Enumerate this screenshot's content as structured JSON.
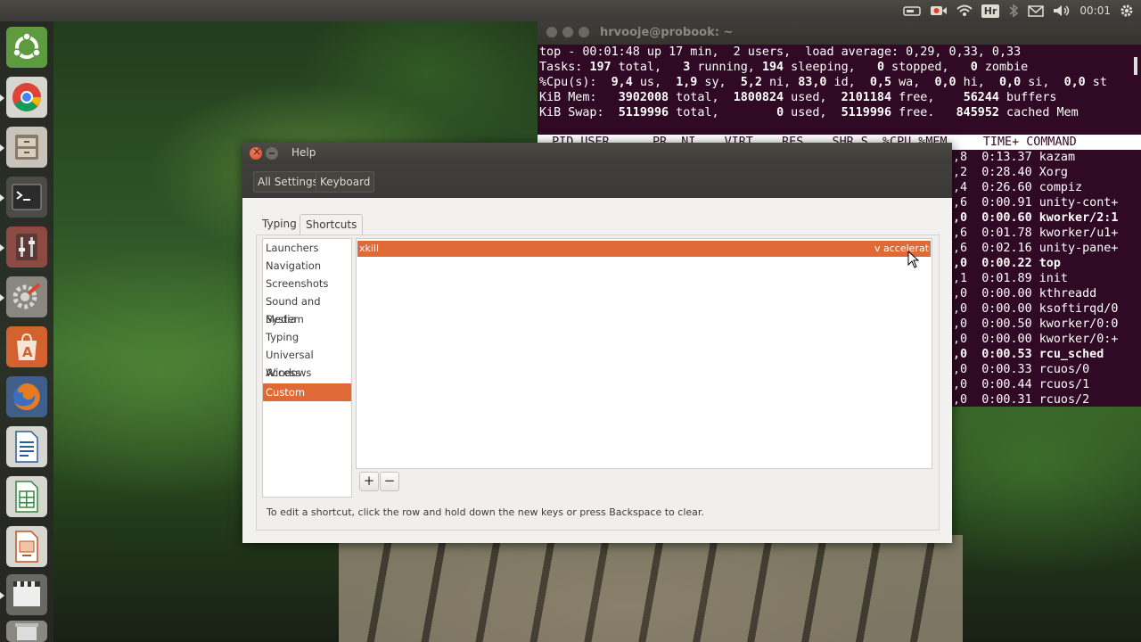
{
  "panel": {
    "clock": "00:01",
    "keyboard_layout": "Hr",
    "icons": [
      "drive-icon",
      "camera-record-icon",
      "wifi-icon",
      "keyboard-layout-icon",
      "bluetooth-icon",
      "mail-icon",
      "volume-icon",
      "clock",
      "gear-icon"
    ]
  },
  "launcher": {
    "items": [
      "dash-home",
      "chrome",
      "file-manager",
      "terminal",
      "system-settings-mixer",
      "tools",
      "software-center",
      "firefox",
      "libreoffice-writer",
      "libreoffice-calc",
      "libreoffice-impress",
      "video-player"
    ]
  },
  "terminal": {
    "title": "hrvooje@probook: ~",
    "line1": "top - 00:01:48 up 17 min,  2 users,  load average: 0,29, 0,33, 0,33",
    "tasks": {
      "label": "Tasks:",
      "total": "197",
      "total_l": " total,",
      "running": "3",
      "running_l": " running,",
      "sleeping": "194",
      "sleeping_l": " sleeping,",
      "stopped": "0",
      "stopped_l": " stopped,",
      "zombie": "0",
      "zombie_l": " zombie"
    },
    "cpu": {
      "label": "%Cpu(s):",
      "us": "9,4",
      "us_l": " us,",
      "sy": "1,9",
      "sy_l": " sy,",
      "ni": "5,2",
      "ni_l": " ni,",
      "id": "83,0",
      "id_l": " id,",
      "wa": "0,5",
      "wa_l": " wa,",
      "hi": "0,0",
      "hi_l": " hi,",
      "si": "0,0",
      "si_l": " si,",
      "st": "0,0",
      "st_l": " st"
    },
    "mem": {
      "label": "KiB Mem: ",
      "total": "3902008",
      "total_l": " total,",
      "used": "1800824",
      "used_l": " used,",
      "free": "2101184",
      "free_l": " free,",
      "buffers": "56244",
      "buffers_l": " buffers"
    },
    "swap": {
      "label": "KiB Swap:",
      "total": "5119996",
      "total_l": " total,",
      "used": "0",
      "used_l": " used,",
      "free": "5119996",
      "free_l": " free.",
      "cached": "845952",
      "cached_l": " cached Mem"
    },
    "header": "  PID USER      PR  NI    VIRT    RES    SHR S  %CPU %MEM     TIME+ COMMAND",
    "processes": [
      {
        "mem": ",8",
        "time": "0:13.37",
        "cmd": "kazam",
        "bold": false
      },
      {
        "mem": ",2",
        "time": "0:28.40",
        "cmd": "Xorg",
        "bold": false
      },
      {
        "mem": ",4",
        "time": "0:26.60",
        "cmd": "compiz",
        "bold": false
      },
      {
        "mem": ",6",
        "time": "0:00.91",
        "cmd": "unity-cont+",
        "bold": false
      },
      {
        "mem": ",0",
        "time": "0:00.60",
        "cmd": "kworker/2:1",
        "bold": true
      },
      {
        "mem": ",6",
        "time": "0:01.78",
        "cmd": "kworker/u1+",
        "bold": false
      },
      {
        "mem": ",6",
        "time": "0:02.16",
        "cmd": "unity-pane+",
        "bold": false
      },
      {
        "mem": ",0",
        "time": "0:00.22",
        "cmd": "top",
        "bold": true
      },
      {
        "mem": ",1",
        "time": "0:01.89",
        "cmd": "init",
        "bold": false
      },
      {
        "mem": ",0",
        "time": "0:00.00",
        "cmd": "kthreadd",
        "bold": false
      },
      {
        "mem": ",0",
        "time": "0:00.00",
        "cmd": "ksoftirqd/0",
        "bold": false
      },
      {
        "mem": ",0",
        "time": "0:00.50",
        "cmd": "kworker/0:0",
        "bold": false
      },
      {
        "mem": ",0",
        "time": "0:00.00",
        "cmd": "kworker/0:+",
        "bold": false
      },
      {
        "mem": ",0",
        "time": "0:00.53",
        "cmd": "rcu_sched",
        "bold": true
      },
      {
        "mem": ",0",
        "time": "0:00.33",
        "cmd": "rcuos/0",
        "bold": false
      },
      {
        "mem": ",0",
        "time": "0:00.44",
        "cmd": "rcuos/1",
        "bold": false
      },
      {
        "mem": ",0",
        "time": "0:00.31",
        "cmd": "rcuos/2",
        "bold": false
      }
    ]
  },
  "dialog": {
    "title": "Help",
    "breadcrumbs": [
      "All Settings",
      "Keyboard"
    ],
    "tabs": [
      "Typing",
      "Shortcuts"
    ],
    "active_tab": "Shortcuts",
    "categories": [
      "Launchers",
      "Navigation",
      "Screenshots",
      "Sound and Media",
      "System",
      "Typing",
      "Universal Access",
      "Windows",
      "Custom Shortcuts"
    ],
    "selected_category": "Custom Shortcuts",
    "shortcut": {
      "name": "xkill",
      "accelerator": "v acceleratc"
    },
    "add_label": "+",
    "remove_label": "−",
    "hint": "To edit a shortcut, click the row and hold down the new keys or press Backspace to clear.",
    "accent_color": "#e06a35"
  }
}
